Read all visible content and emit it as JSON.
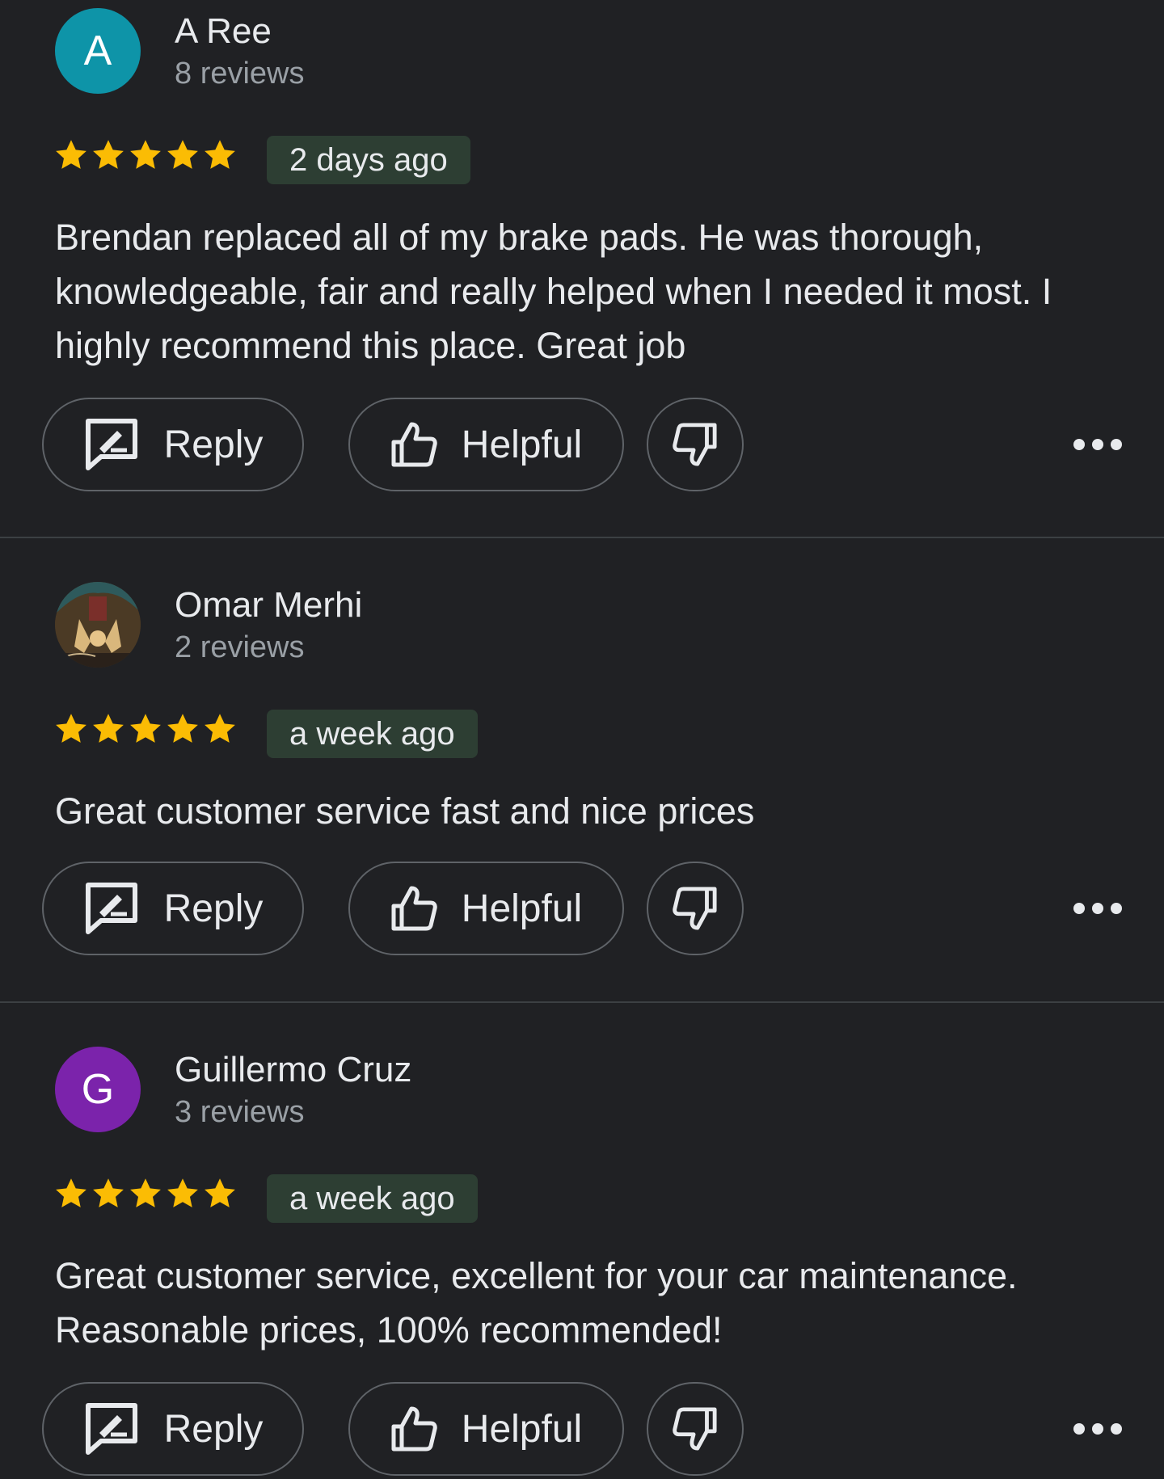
{
  "reviews": [
    {
      "avatar_letter": "A",
      "avatar_color": "#0e94a8",
      "name": "A Ree",
      "review_count": "8 reviews",
      "rating": 5,
      "time_ago": "2 days ago",
      "text": "Brendan replaced all of my brake pads. He was thorough, knowledgeable, fair and really helped when I needed it most. I highly recommend this place. Great job",
      "reply_label": "Reply",
      "helpful_label": "Helpful"
    },
    {
      "avatar_letter": "",
      "avatar_color": "#6b5232",
      "name": "Omar Merhi",
      "review_count": "2 reviews",
      "rating": 5,
      "time_ago": "a week ago",
      "text": "Great customer service fast and nice prices",
      "reply_label": "Reply",
      "helpful_label": "Helpful"
    },
    {
      "avatar_letter": "G",
      "avatar_color": "#7b23ab",
      "name": "Guillermo Cruz",
      "review_count": "3 reviews",
      "rating": 5,
      "time_ago": "a week ago",
      "text": "Great customer service, excellent for your car maintenance. Reasonable prices, 100% recommended!",
      "reply_label": "Reply",
      "helpful_label": "Helpful"
    }
  ],
  "colors": {
    "background": "#202124",
    "star": "#fbbc04",
    "badge_bg": "#2d3e33",
    "border": "#5f6368",
    "divider": "#3c4043",
    "text_primary": "#e8eaed",
    "text_secondary": "#9aa0a6"
  },
  "icons": {
    "reply": "reply-icon",
    "helpful": "thumbs-up-icon",
    "dislike": "thumbs-down-icon",
    "more": "more-horiz-icon",
    "star": "star-icon"
  }
}
